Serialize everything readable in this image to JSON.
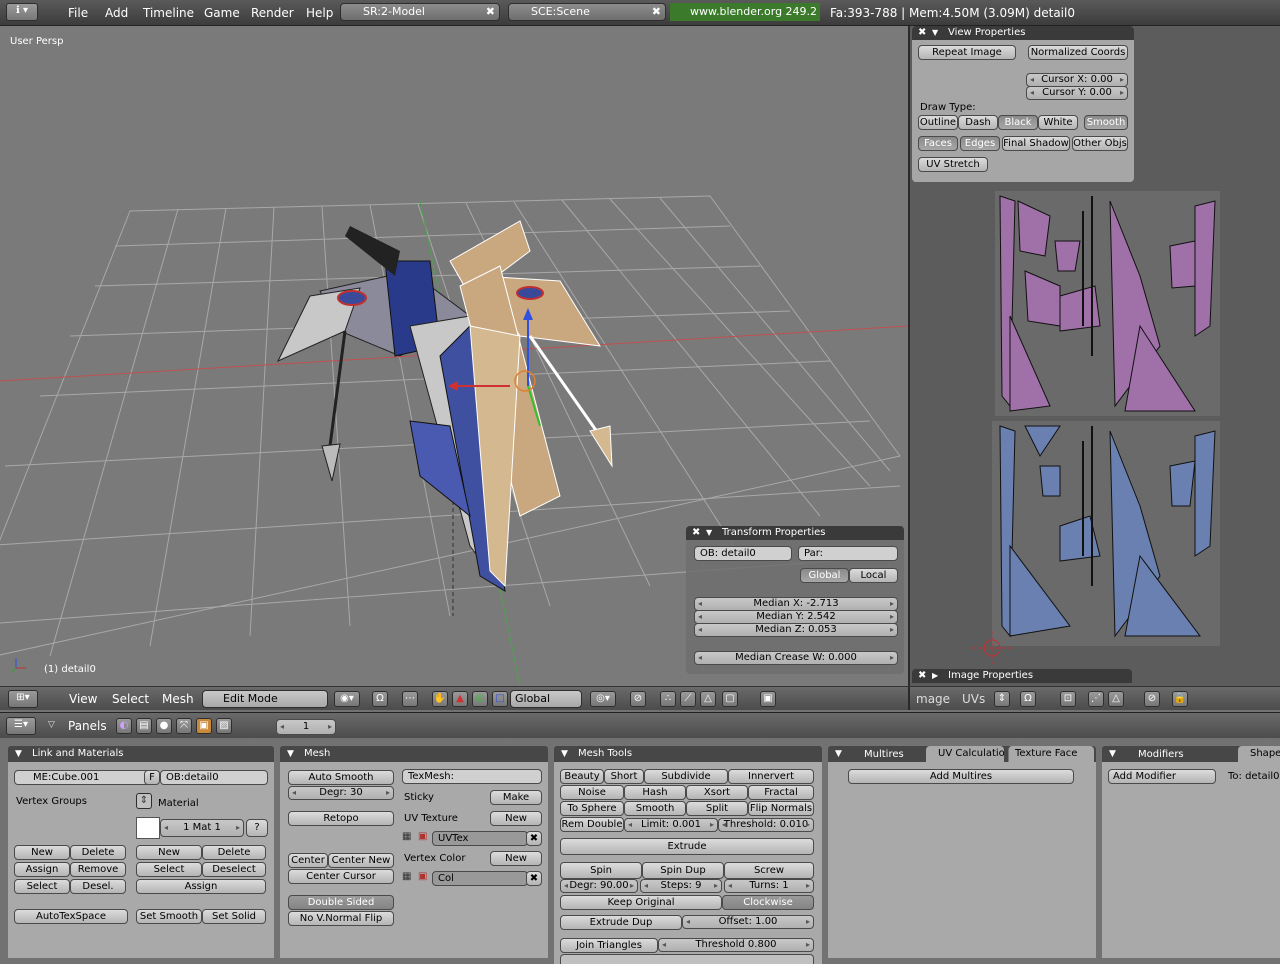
{
  "topbar": {
    "menus": [
      "File",
      "Add",
      "Timeline",
      "Game",
      "Render",
      "Help"
    ],
    "screen": "SR:2-Model",
    "scene": "SCE:Scene",
    "url": "www.blender.org 249.2",
    "stats": "Fa:393-788 | Mem:4.50M (3.09M) detail0"
  },
  "viewport": {
    "persp": "User Persp",
    "object_label": "(1) detail0"
  },
  "view_properties": {
    "title": "View Properties",
    "repeat_image": "Repeat Image",
    "normalized_coords": "Normalized Coords",
    "cursor_x": "Cursor X: 0.00",
    "cursor_y": "Cursor Y: 0.00",
    "draw_type_label": "Draw Type:",
    "draw_types": [
      "Outline",
      "Dash",
      "Black",
      "White",
      "Smooth"
    ],
    "options": [
      "Faces",
      "Edges",
      "Final Shadow",
      "Other Objs"
    ],
    "uv_stretch": "UV Stretch"
  },
  "transform_properties": {
    "title": "Transform Properties",
    "ob": "OB: detail0",
    "par": "Par:",
    "global": "Global",
    "local": "Local",
    "median_x": "Median X: -2.713",
    "median_y": "Median Y: 2.542",
    "median_z": "Median Z: 0.053",
    "median_crease": "Median Crease W: 0.000"
  },
  "image_properties": {
    "title": "Image Properties"
  },
  "view3d_header": {
    "menus": [
      "View",
      "Select",
      "Mesh"
    ],
    "mode": "Edit Mode",
    "orientation": "Global"
  },
  "image_header": {
    "menus": [
      "mage",
      "UVs"
    ]
  },
  "buttons_header": {
    "panels_label": "Panels",
    "frame": "1"
  },
  "link_materials": {
    "title": "Link and Materials",
    "me": "ME:Cube.001",
    "f": "F",
    "ob": "OB:detail0",
    "vertex_groups": "Vertex Groups",
    "material": "Material",
    "mat": "1 Mat 1",
    "q": "?",
    "vg_buttons": [
      "New",
      "Delete",
      "Assign",
      "Remove",
      "Select",
      "Desel."
    ],
    "mat_buttons": [
      "New",
      "Delete",
      "Select",
      "Deselect",
      "Assign"
    ],
    "autotexspace": "AutoTexSpace",
    "set_smooth": "Set Smooth",
    "set_solid": "Set Solid"
  },
  "mesh": {
    "title": "Mesh",
    "auto_smooth": "Auto Smooth",
    "degr": "Degr: 30",
    "retopo": "Retopo",
    "center": "Center",
    "center_new": "Center New",
    "center_cursor": "Center Cursor",
    "double_sided": "Double Sided",
    "no_vnormal_flip": "No V.Normal Flip",
    "texmesh": "TexMesh:",
    "sticky": "Sticky",
    "make": "Make",
    "uv_texture": "UV Texture",
    "uv_new": "New",
    "uvtex": "UVTex",
    "vertex_color": "Vertex Color",
    "vc_new": "New",
    "col": "Col"
  },
  "mesh_tools": {
    "title": "Mesh Tools",
    "row1": [
      "Beauty",
      "Short",
      "Subdivide",
      "Innervert"
    ],
    "row2": [
      "Noise",
      "Hash",
      "Xsort",
      "Fractal"
    ],
    "row3": [
      "To Sphere",
      "Smooth",
      "Split",
      "Flip Normals"
    ],
    "rem_double": "Rem Double",
    "limit": "Limit: 0.001",
    "threshold": "Threshold: 0.010",
    "extrude": "Extrude",
    "spin": "Spin",
    "spin_dup": "Spin Dup",
    "screw": "Screw",
    "degr": "Degr: 90.00",
    "steps": "Steps: 9",
    "turns": "Turns: 1",
    "keep_original": "Keep Original",
    "clockwise": "Clockwise",
    "extrude_dup": "Extrude Dup",
    "offset": "Offset: 1.00",
    "join_triangles": "Join Triangles",
    "jt_threshold": "Threshold 0.800"
  },
  "multires": {
    "tabs": [
      "Multires",
      "UV Calculatio",
      "Texture Face"
    ],
    "add_multires": "Add Multires"
  },
  "modifiers": {
    "tabs": [
      "Modifiers",
      "Shape"
    ],
    "add_modifier": "Add Modifier",
    "to": "To: detail0"
  }
}
